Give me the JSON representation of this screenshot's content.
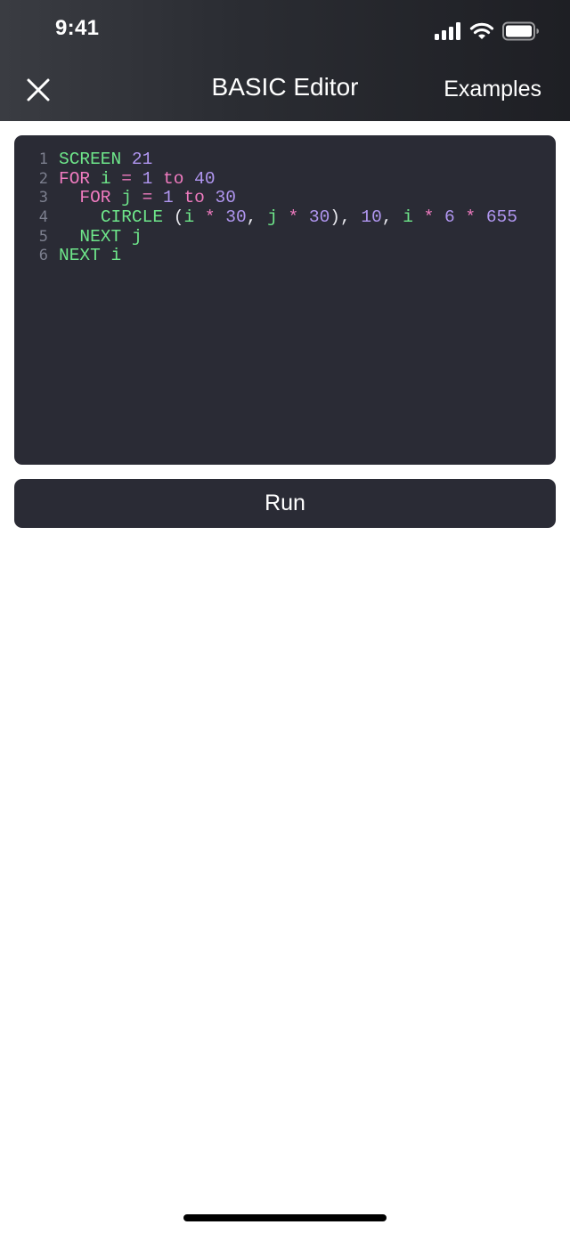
{
  "status_bar": {
    "time": "9:41"
  },
  "header": {
    "title": "BASIC Editor",
    "examples_label": "Examples"
  },
  "editor": {
    "colors": {
      "keyword": "#6ee68a",
      "flow": "#f07bc0",
      "number": "#b096f0",
      "plain": "#e8e8ee",
      "line_number": "#7c7f8e",
      "background": "#2a2b35"
    },
    "lines": [
      {
        "number": "1",
        "tokens": [
          {
            "text": "SCREEN",
            "kind": "keyword"
          },
          {
            "text": " ",
            "kind": "plain"
          },
          {
            "text": "21",
            "kind": "number"
          }
        ]
      },
      {
        "number": "2",
        "tokens": [
          {
            "text": "FOR",
            "kind": "flow"
          },
          {
            "text": " ",
            "kind": "plain"
          },
          {
            "text": "i",
            "kind": "keyword"
          },
          {
            "text": " ",
            "kind": "plain"
          },
          {
            "text": "=",
            "kind": "flow"
          },
          {
            "text": " ",
            "kind": "plain"
          },
          {
            "text": "1",
            "kind": "number"
          },
          {
            "text": " ",
            "kind": "plain"
          },
          {
            "text": "to",
            "kind": "flow"
          },
          {
            "text": " ",
            "kind": "plain"
          },
          {
            "text": "40",
            "kind": "number"
          }
        ]
      },
      {
        "number": "3",
        "tokens": [
          {
            "text": "  ",
            "kind": "plain"
          },
          {
            "text": "FOR",
            "kind": "flow"
          },
          {
            "text": " ",
            "kind": "plain"
          },
          {
            "text": "j",
            "kind": "keyword"
          },
          {
            "text": " ",
            "kind": "plain"
          },
          {
            "text": "=",
            "kind": "flow"
          },
          {
            "text": " ",
            "kind": "plain"
          },
          {
            "text": "1",
            "kind": "number"
          },
          {
            "text": " ",
            "kind": "plain"
          },
          {
            "text": "to",
            "kind": "flow"
          },
          {
            "text": " ",
            "kind": "plain"
          },
          {
            "text": "30",
            "kind": "number"
          }
        ]
      },
      {
        "number": "4",
        "tokens": [
          {
            "text": "    ",
            "kind": "plain"
          },
          {
            "text": "CIRCLE",
            "kind": "keyword"
          },
          {
            "text": " ",
            "kind": "plain"
          },
          {
            "text": "(",
            "kind": "plain"
          },
          {
            "text": "i",
            "kind": "keyword"
          },
          {
            "text": " ",
            "kind": "plain"
          },
          {
            "text": "*",
            "kind": "flow"
          },
          {
            "text": " ",
            "kind": "plain"
          },
          {
            "text": "30",
            "kind": "number"
          },
          {
            "text": ", ",
            "kind": "plain"
          },
          {
            "text": "j",
            "kind": "keyword"
          },
          {
            "text": " ",
            "kind": "plain"
          },
          {
            "text": "*",
            "kind": "flow"
          },
          {
            "text": " ",
            "kind": "plain"
          },
          {
            "text": "30",
            "kind": "number"
          },
          {
            "text": "), ",
            "kind": "plain"
          },
          {
            "text": "10",
            "kind": "number"
          },
          {
            "text": ", ",
            "kind": "plain"
          },
          {
            "text": "i",
            "kind": "keyword"
          },
          {
            "text": " ",
            "kind": "plain"
          },
          {
            "text": "*",
            "kind": "flow"
          },
          {
            "text": " ",
            "kind": "plain"
          },
          {
            "text": "6",
            "kind": "number"
          },
          {
            "text": " ",
            "kind": "plain"
          },
          {
            "text": "*",
            "kind": "flow"
          },
          {
            "text": " ",
            "kind": "plain"
          },
          {
            "text": "655",
            "kind": "number"
          }
        ]
      },
      {
        "number": "5",
        "tokens": [
          {
            "text": "  ",
            "kind": "plain"
          },
          {
            "text": "NEXT",
            "kind": "keyword"
          },
          {
            "text": " ",
            "kind": "plain"
          },
          {
            "text": "j",
            "kind": "keyword"
          }
        ]
      },
      {
        "number": "6",
        "tokens": [
          {
            "text": "NEXT",
            "kind": "keyword"
          },
          {
            "text": " ",
            "kind": "plain"
          },
          {
            "text": "i",
            "kind": "keyword"
          }
        ]
      }
    ]
  },
  "run_button": {
    "label": "Run"
  },
  "icons": {
    "close": "close-icon",
    "signal": "cellular-signal-icon",
    "wifi": "wifi-icon",
    "battery": "battery-icon"
  }
}
